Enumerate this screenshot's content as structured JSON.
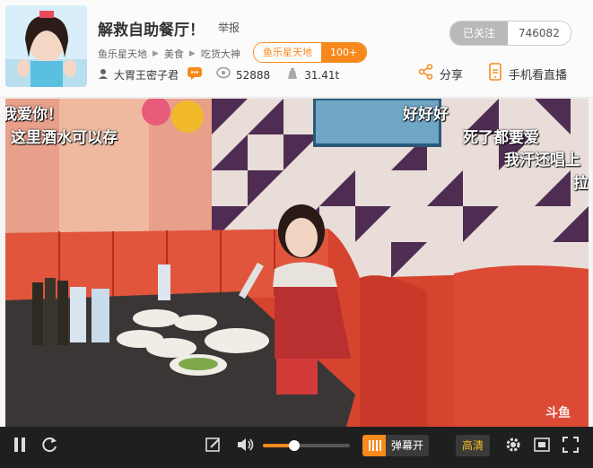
{
  "header": {
    "title": "解救自助餐厅！",
    "report": "举报",
    "breadcrumbs": [
      "鱼乐星天地",
      "美食",
      "吃货大神"
    ],
    "fan_badge": {
      "name": "鱼乐星天地",
      "level": "100+"
    },
    "streamer": "大胃王密子君",
    "viewers": "52888",
    "weight": "31.41t",
    "follow_label": "已关注",
    "follow_count": "746082",
    "share_label": "分享",
    "mobile_label": "手机看直播"
  },
  "video": {
    "danmaku": [
      "我爱你！",
      "这里酒水可以存",
      "好好好",
      "死了都要爱",
      "我汗还唱上",
      "拉"
    ],
    "watermark": "斗鱼"
  },
  "controls": {
    "danmu_label": "弹幕开",
    "quality_label": "高清",
    "volume": 0.36
  },
  "colors": {
    "accent": "#f7891d",
    "bar_bg": "#1f1f1f"
  }
}
